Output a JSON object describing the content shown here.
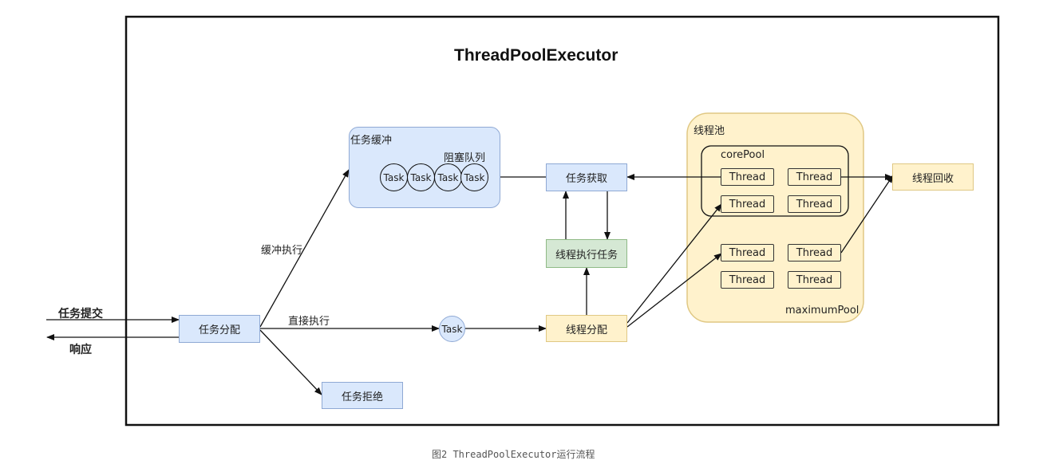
{
  "diagram": {
    "title": "ThreadPoolExecutor",
    "caption": "图2 ThreadPoolExecutor运行流程",
    "left_labels": {
      "submit": "任务提交",
      "response": "响应"
    },
    "dispatch": "任务分配",
    "buffer": {
      "label": "任务缓冲",
      "queue_label": "阻塞队列",
      "task": "Task"
    },
    "edge_labels": {
      "buffer_exec": "缓冲执行",
      "direct_exec": "直接执行"
    },
    "reject": "任务拒绝",
    "task_node": "Task",
    "fetch": "任务获取",
    "execute": "线程执行任务",
    "thread_assign": "线程分配",
    "pool": {
      "label": "线程池",
      "core_label": "corePool",
      "max_label": "maximumPool",
      "thread": "Thread"
    },
    "recycle": "线程回收"
  },
  "colors": {
    "blue_fill": "#dae8fc",
    "yellow_fill": "#fff2cc",
    "green_fill": "#d5e8d4",
    "pool_fill": "#fff2cc"
  }
}
